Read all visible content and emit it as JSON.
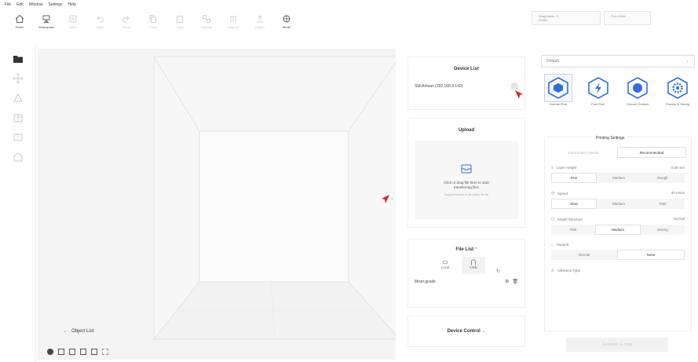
{
  "menu": [
    "File",
    "Edit",
    "Window",
    "Settings",
    "Help"
  ],
  "toolbar": {
    "buttons": [
      {
        "label": "Home",
        "icon": "home-icon",
        "enabled": true
      },
      {
        "label": "Workspace",
        "icon": "workspace-icon",
        "enabled": true
      },
      {
        "label": "Open",
        "icon": "open-icon",
        "enabled": false
      },
      {
        "label": "Undo",
        "icon": "undo-icon",
        "enabled": false
      },
      {
        "label": "Redo",
        "icon": "redo-icon",
        "enabled": false
      },
      {
        "label": "Copy",
        "icon": "copy-icon",
        "enabled": false
      },
      {
        "label": "Copy",
        "icon": "copy-icon",
        "enabled": false
      },
      {
        "label": "Arrange",
        "icon": "arrange-icon",
        "enabled": false
      },
      {
        "label": "Support",
        "icon": "support-icon",
        "enabled": false
      },
      {
        "label": "Export",
        "icon": "export-icon",
        "enabled": false
      },
      {
        "label": "Mode",
        "icon": "mode-icon",
        "enabled": true
      }
    ],
    "printer_selector": "SnapMaker J1",
    "printer_selector_sub": "Profile",
    "material_selector": "PLA-White"
  },
  "object_list": {
    "label": "Object List"
  },
  "device_list": {
    "title": "Device List",
    "device": "SM-Artisan (192.168.2.142)"
  },
  "upload": {
    "title": "Upload",
    "hint": "Click or drag file here to start transferring files",
    "sub_hint": "Support transfer to the printer file list"
  },
  "file_list": {
    "title": "File List",
    "tabs": [
      {
        "label": "Local"
      },
      {
        "label": "USB"
      }
    ],
    "items": [
      {
        "name": "Mixer.gcode"
      }
    ]
  },
  "device_control": {
    "title": "Device Control"
  },
  "print_settings": {
    "profile": "Default",
    "presets": [
      {
        "label": "Normal Print"
      },
      {
        "label": "Fast Print"
      },
      {
        "label": "Smooth Surface"
      },
      {
        "label": "Precise & Strong"
      }
    ],
    "section_title": "Printing Settings",
    "tabs": [
      "Parameters Details",
      "Recommended"
    ],
    "rows": [
      {
        "label": "Layer Height",
        "value": "0.08 mm",
        "options": [
          "Fine",
          "Medium",
          "Rough"
        ],
        "selected": 0
      },
      {
        "label": "Speed",
        "value": "40 mm/s",
        "options": [
          "Slow",
          "Medium",
          "Fast"
        ],
        "selected": 0
      },
      {
        "label": "Model Structure",
        "value": "Normal",
        "options": [
          "Thin",
          "Medium",
          "Strong"
        ],
        "selected": 1
      },
      {
        "label": "Support",
        "value": "",
        "options": [
          "Normal",
          "None"
        ],
        "selected": 1
      },
      {
        "label": "Adhesion Type",
        "value": "",
        "options": [],
        "selected": -1
      }
    ],
    "generate": "Generate G-code"
  },
  "colors": {
    "accent": "#2f6fd6",
    "cursor": "#e02020",
    "border": "#eeeeee",
    "viewport_bg": "#f4f4f4"
  }
}
